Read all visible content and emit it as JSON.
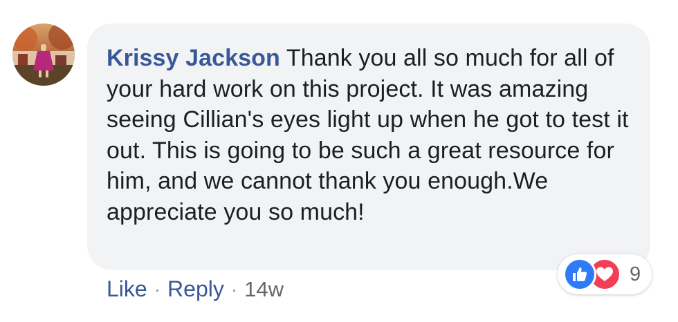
{
  "comment": {
    "author": "Krissy Jackson",
    "text": "Thank you all so much for all of your hard work on this project. It was amazing seeing Cillian's eyes light up when he got to test it out. This is going to be such a great resource for him, and we cannot thank you enough.We appreciate you so much!",
    "avatar_icon": "profile-photo"
  },
  "reactions": {
    "types": [
      "like-icon",
      "love-icon"
    ],
    "count": "9"
  },
  "actions": {
    "like_label": "Like",
    "separator": "·",
    "reply_label": "Reply",
    "timestamp": "14w"
  },
  "colors": {
    "link": "#385898",
    "bubble": "#f2f3f5",
    "like": "#2f7bf5",
    "love": "#f33e58"
  }
}
